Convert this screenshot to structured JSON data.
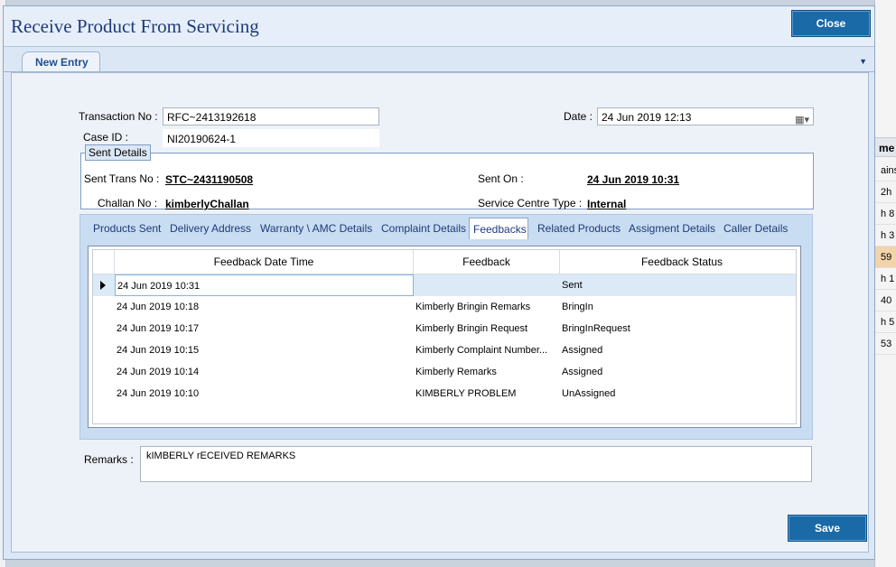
{
  "window": {
    "title": "Receive Product From Servicing",
    "close_label": "Close",
    "save_label": "Save"
  },
  "tabs": {
    "new_entry": "New Entry"
  },
  "form": {
    "transaction_no_label": "Transaction No :",
    "transaction_no_value": "RFC~2413192618",
    "case_id_label": "Case ID :",
    "case_id_value": "NI20190624-1",
    "date_label": "Date :",
    "date_value": "24 Jun  2019 12:13",
    "remarks_label": "Remarks :",
    "remarks_value": "kIMBERLY rECEIVED REMARKS"
  },
  "sent_details": {
    "title": "Sent Details",
    "sent_trans_no_label": "Sent Trans No :",
    "sent_trans_no_value": "STC~2431190508",
    "sent_on_label": "Sent On :",
    "sent_on_value": "24 Jun 2019 10:31",
    "challan_no_label": "Challan No :",
    "challan_no_value": "kimberlyChallan",
    "service_centre_type_label": "Service Centre Type :",
    "service_centre_type_value": "Internal"
  },
  "detail_tabs": [
    "Products Sent",
    "Delivery Address",
    "Warranty \\ AMC Details",
    "Complaint Details",
    "Feedbacks",
    "Related Products",
    "Assigment Details",
    "Caller Details"
  ],
  "feedback_grid": {
    "columns": [
      "Feedback Date Time",
      "Feedback",
      "Feedback Status"
    ],
    "rows": [
      [
        "24 Jun 2019 10:31",
        "",
        "Sent"
      ],
      [
        "24 Jun 2019 10:18",
        "Kimberly Bringin Remarks",
        "BringIn"
      ],
      [
        "24 Jun 2019 10:17",
        "Kimberly Bringin Request",
        "BringInRequest"
      ],
      [
        "24 Jun 2019 10:15",
        "Kimberly Complaint Number...",
        "Assigned"
      ],
      [
        "24 Jun 2019 10:14",
        "Kimberly Remarks",
        "Assigned"
      ],
      [
        "24 Jun 2019 10:10",
        "KIMBERLY PROBLEM",
        "UnAssigned"
      ]
    ]
  },
  "background_app": {
    "header": "me",
    "cells": [
      "ains",
      "2h",
      "h 8",
      "h 3",
      "59",
      "h 1",
      "40",
      "h 5",
      "53"
    ]
  },
  "icons": {
    "calendar": "calendar-icon",
    "dropdown": "chevron-down-icon",
    "row_pointer": "row-pointer-icon"
  },
  "colors": {
    "accent_button": "#1a6aa8",
    "title_text": "#1f3a78",
    "selected_row": "#dceaf7"
  }
}
